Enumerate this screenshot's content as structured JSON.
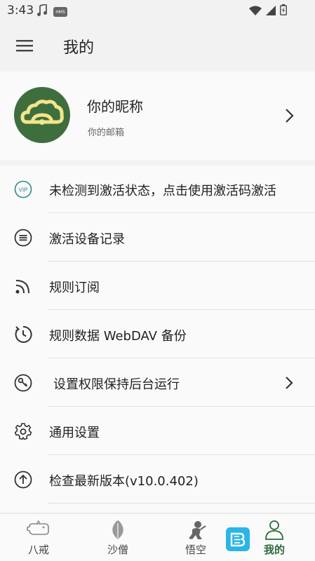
{
  "status_bar": {
    "time": "3:43",
    "hms_badge": "HMS"
  },
  "app_bar": {
    "title": "我的"
  },
  "profile": {
    "nickname": "你的昵称",
    "email": "你的邮箱"
  },
  "menu": {
    "items": [
      {
        "label": "未检测到激活状态，点击使用激活码激活",
        "icon": "vip-icon"
      },
      {
        "label": "激活设备记录",
        "icon": "list-circle-icon"
      },
      {
        "label": "规则订阅",
        "icon": "rss-icon"
      },
      {
        "label": "规则数据 WebDAV 备份",
        "icon": "backup-clock-icon"
      },
      {
        "label": "设置权限保持后台运行",
        "icon": "key-icon"
      },
      {
        "label": "通用设置",
        "icon": "gear-icon"
      },
      {
        "label": "检查最新版本(v10.0.402)",
        "icon": "upload-circle-icon"
      }
    ]
  },
  "bottom_nav": {
    "items": [
      {
        "label": "八戒",
        "icon": "pig-icon"
      },
      {
        "label": "沙僧",
        "icon": "leaf-icon"
      },
      {
        "label": "悟空",
        "icon": "monkey-icon"
      },
      {
        "label": "我的",
        "icon": "person-icon",
        "active": true
      }
    ]
  },
  "colors": {
    "accent": "#2b6b3c",
    "avatar_bg": "#3f6e3e",
    "vip_icon": "#2f8a8a"
  }
}
